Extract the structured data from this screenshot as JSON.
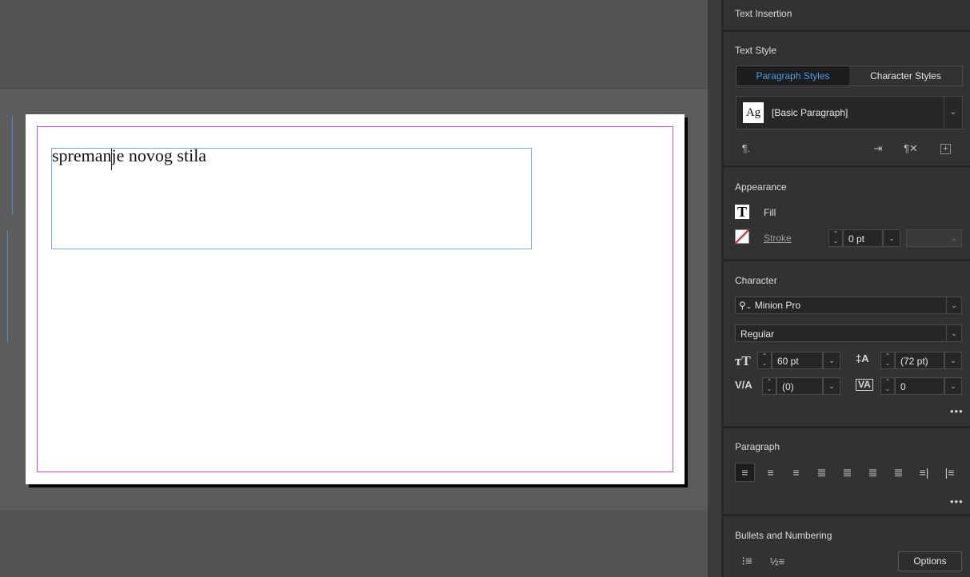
{
  "document": {
    "frame_text": "spremanje novog stila"
  },
  "panel": {
    "text_insertion_title": "Text Insertion",
    "text_style": {
      "title": "Text Style",
      "tabs": [
        "Paragraph Styles",
        "Character Styles"
      ],
      "active_tab": "Paragraph Styles",
      "style_preview": "Ag",
      "selected_style": "[Basic Paragraph]"
    },
    "appearance": {
      "title": "Appearance",
      "fill_label": "Fill",
      "stroke_label": "Stroke",
      "stroke_weight": "0 pt"
    },
    "character": {
      "title": "Character",
      "font_family": "Minion Pro",
      "font_style": "Regular",
      "font_size": "60 pt",
      "leading": "(72 pt)",
      "kerning": "(0)",
      "tracking": "0"
    },
    "paragraph": {
      "title": "Paragraph",
      "alignments": [
        "align-left",
        "align-center",
        "align-right",
        "justify-left",
        "justify-center",
        "justify-right",
        "justify-all",
        "align-towards-spine",
        "align-away-from-spine"
      ],
      "active_alignment": "align-left"
    },
    "bullets": {
      "title": "Bullets and Numbering",
      "options_label": "Options"
    }
  },
  "colors": {
    "accent": "#4f9be8",
    "margin_guide": "#c850e6",
    "frame_border": "#7aa7e8",
    "panel_bg": "#323232"
  }
}
